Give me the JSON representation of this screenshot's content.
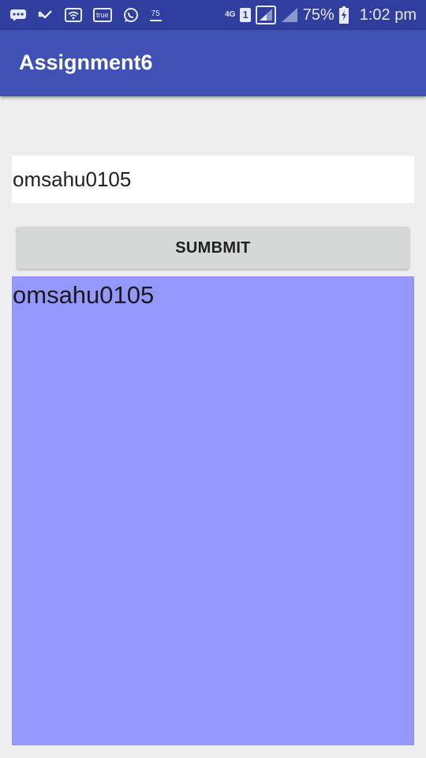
{
  "status_bar": {
    "icons": [
      "message-icon",
      "missed-call-icon",
      "wifi-icon",
      "true-app-icon",
      "whatsapp-icon",
      "notification-75-icon",
      "network-4g-icon",
      "sim-1-icon",
      "signal-sim1-icon",
      "signal-sim2-icon",
      "battery-charging-icon"
    ],
    "true_label": "true",
    "notification_count": "75",
    "network_type": "4G",
    "sim_number": "1",
    "battery": "75%",
    "time": "1:02 pm",
    "background_color": "#303f9f"
  },
  "app_bar": {
    "title": "Assignment6",
    "background_color": "#3f51b5"
  },
  "main": {
    "input_value": "omsahu0105",
    "submit_label": "SUMBMIT",
    "output_text": "omsahu0105",
    "output_background": "#9498fc"
  }
}
